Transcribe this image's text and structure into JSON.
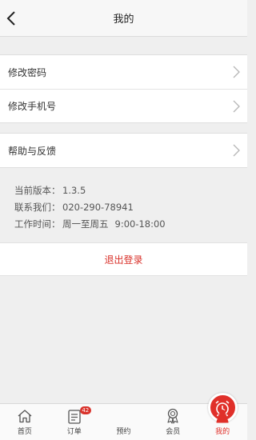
{
  "header": {
    "title": "我的"
  },
  "menu": {
    "group1": [
      {
        "label": "修改密码"
      },
      {
        "label": "修改手机号"
      }
    ],
    "group2": [
      {
        "label": "帮助与反馈"
      }
    ]
  },
  "info": {
    "version_label": "当前版本：",
    "version_value": "1.3.5",
    "contact_label": "联系我们：",
    "contact_value": "020-290-78941",
    "hours_label": "工作时间：",
    "hours_days": "周一至周五",
    "hours_time": "9:00-18:00"
  },
  "logout": {
    "label": "退出登录"
  },
  "tabbar": {
    "home": "首页",
    "orders": "订单",
    "orders_badge": "42",
    "booking": "预约",
    "member": "会员",
    "mine": "我的"
  },
  "colors": {
    "accent": "#e0302a",
    "background": "#efefef"
  }
}
